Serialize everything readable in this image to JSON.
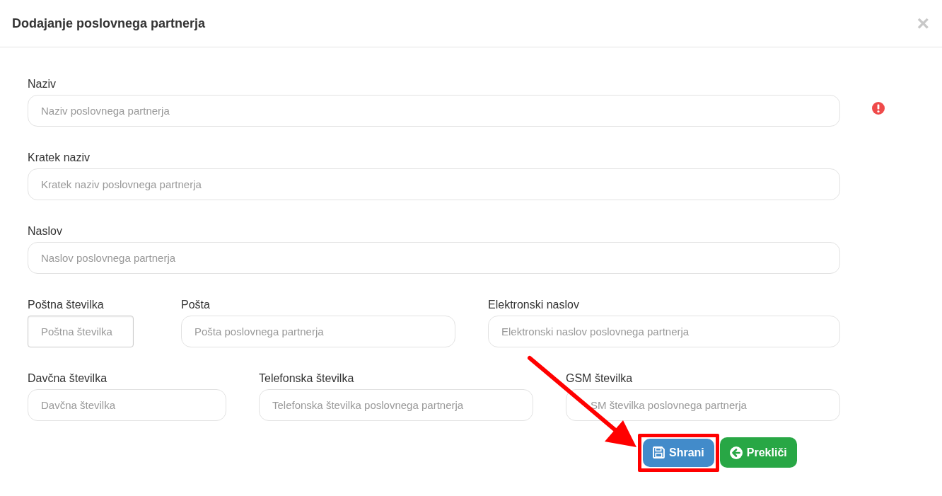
{
  "dialog": {
    "title": "Dodajanje poslovnega partnerja",
    "close": "×"
  },
  "form_rows": [
    [
      {
        "label": "Naziv",
        "placeholder": "Naziv poslovnega partnerja",
        "kind": "rounded",
        "invalid": true
      }
    ],
    [
      {
        "label": "Kratek naziv",
        "placeholder": "Kratek naziv poslovnega partnerja",
        "kind": "rounded",
        "invalid": false
      }
    ],
    [
      {
        "label": "Naslov",
        "placeholder": "Naslov poslovnega partnerja",
        "kind": "rounded",
        "invalid": false
      }
    ],
    [
      {
        "label": "Poštna številka",
        "placeholder": "Poštna številka",
        "kind": "square",
        "invalid": false
      },
      {
        "label": "Pošta",
        "placeholder": "Pošta poslovnega partnerja",
        "kind": "rounded",
        "invalid": false
      },
      {
        "label": "Elektronski naslov",
        "placeholder": "Elektronski naslov poslovnega partnerja",
        "kind": "rounded",
        "invalid": false
      }
    ],
    [
      {
        "label": "Davčna številka",
        "placeholder": "Davčna številka",
        "kind": "rounded",
        "invalid": false
      },
      {
        "label": "Telefonska številka",
        "placeholder": "Telefonska številka poslovnega partnerja",
        "kind": "rounded",
        "invalid": false
      },
      {
        "label": "GSM številka",
        "placeholder": "SM številka poslovnega partnerja",
        "kind": "rounded",
        "invalid": false,
        "start_covered": true
      }
    ]
  ],
  "buttons": [
    {
      "label": "Shrani",
      "kind": "save",
      "highlighted": true
    },
    {
      "label": "Prekliči",
      "kind": "cancel",
      "highlighted": false
    }
  ],
  "annotation_arrow": true
}
